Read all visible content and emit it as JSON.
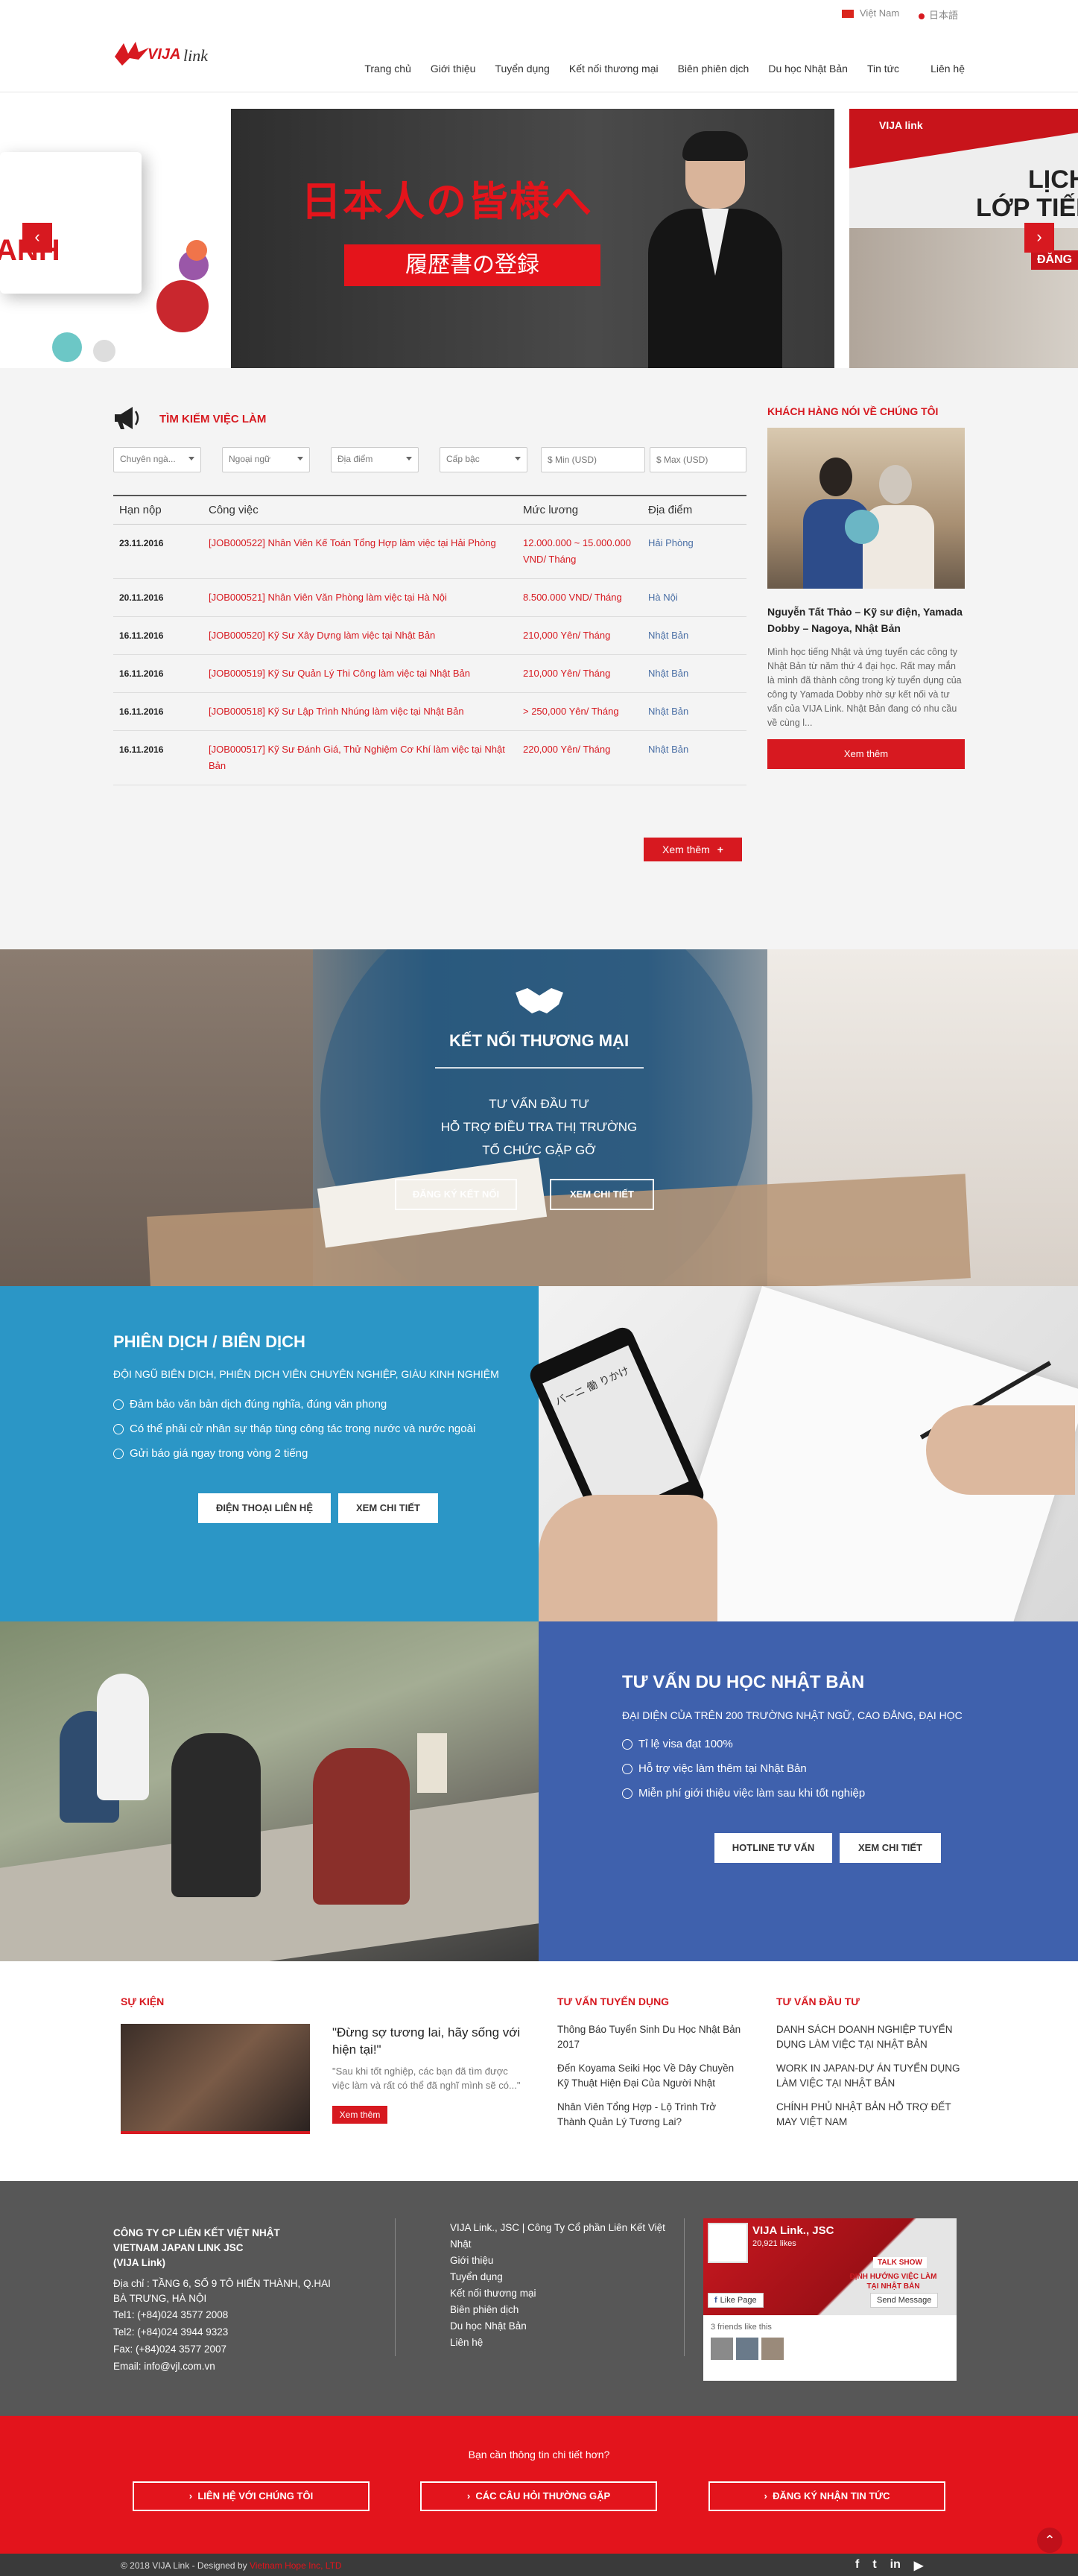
{
  "topbar": {
    "lang_vn": "Việt Nam",
    "lang_jp": "日本語"
  },
  "header": {
    "logo_text": "link",
    "logo_brand": "VIJA",
    "nav": [
      "Trang chủ",
      "Giới thiệu",
      "Tuyển dụng",
      "Kết nối thương mại",
      "Biên phiên dịch",
      "Du học Nhật Bản",
      "Tin tức",
      "Liên hệ"
    ]
  },
  "slider": {
    "left_text": "ANH",
    "main_jp_title": "日本人の皆様へ",
    "main_jp_sub": "履歴書の登録",
    "right_lines": [
      "LỊCH",
      "LỚP TIẾNG"
    ],
    "right_badge": "ĐĂNG",
    "right_brand": "VIJA link"
  },
  "jobs": {
    "title": "TÌM KIẾM VIỆC LÀM",
    "filters": [
      "Chuyên ngà...",
      "Ngoại ngữ",
      "Địa điểm",
      "Cấp bậc"
    ],
    "min_placeholder": "$ Min (USD)",
    "max_placeholder": "$ Max (USD)",
    "headers": [
      "Hạn nộp",
      "Công việc",
      "Mức lương",
      "Địa điểm"
    ],
    "rows": [
      {
        "date": "23.11.2016",
        "title": "[JOB000522] Nhân Viên Kế Toán Tổng Hợp làm việc tại Hải Phòng",
        "salary": "12.000.000 ~ 15.000.000 VND/ Tháng",
        "loc": "Hải Phòng"
      },
      {
        "date": "20.11.2016",
        "title": "[JOB000521] Nhân Viên Văn Phòng làm việc tại Hà Nội",
        "salary": "8.500.000 VND/ Tháng",
        "loc": "Hà Nội"
      },
      {
        "date": "16.11.2016",
        "title": "[JOB000520] Kỹ Sư Xây Dựng làm việc tại Nhật Bản",
        "salary": "210,000 Yên/ Tháng",
        "loc": "Nhật Bản"
      },
      {
        "date": "16.11.2016",
        "title": "[JOB000519] Kỹ Sư Quản Lý Thi Công làm việc tại Nhật Bản",
        "salary": "210,000 Yên/ Tháng",
        "loc": "Nhật Bản"
      },
      {
        "date": "16.11.2016",
        "title": "[JOB000518] Kỹ Sư Lập Trình Nhúng làm việc tại Nhật Bản",
        "salary": "> 250,000 Yên/ Tháng",
        "loc": "Nhật Bản"
      },
      {
        "date": "16.11.2016",
        "title": "[JOB000517] Kỹ Sư Đánh Giá, Thử Nghiệm Cơ Khí làm việc tại Nhật Bản",
        "salary": "220,000 Yên/ Tháng",
        "loc": "Nhật Bản"
      }
    ],
    "more": "Xem thêm"
  },
  "testimonial": {
    "title": "KHÁCH HÀNG NÓI VỀ CHÚNG TÔI",
    "name": "Nguyễn Tất Thảo – Kỹ sư điện, Yamada Dobby – Nagoya, Nhật Bản",
    "text": "Mình học tiếng Nhật và ứng tuyển các công ty Nhật Bản từ năm thứ 4 đại học. Rất may mắn là mình đã thành công trong kỳ tuyển dụng của công ty Yamada Dobby nhờ sự kết nối và tư vấn của VIJA Link. Nhật Bản đang có nhu cầu về cùng l...",
    "more": "Xem thêm"
  },
  "ketnoi": {
    "title": "KẾT NỐI THƯƠNG MẠI",
    "lines": [
      "TƯ VẤN ĐẦU TƯ",
      "HỖ TRỢ ĐIỀU TRA THỊ TRƯỜNG",
      "TỔ CHỨC GẶP GỠ"
    ],
    "btn1": "ĐĂNG KÝ KẾT NỐI",
    "btn2": "XEM CHI TIẾT"
  },
  "translation": {
    "title": "PHIÊN DỊCH / BIÊN DỊCH",
    "subtitle": "ĐỘI NGŨ BIÊN DỊCH, PHIÊN DỊCH VIÊN CHUYÊN NGHIỆP, GIÀU KINH NGHIỆM",
    "bullets": [
      "Đảm bảo văn bản dịch đúng nghĩa, đúng văn phong",
      "Có thể phải cử nhân sự tháp tùng công tác trong nước và nước ngoài",
      "Gửi báo giá ngay trong vòng 2 tiếng"
    ],
    "btn1": "ĐIỆN THOẠI LIÊN HỆ",
    "btn2": "XEM CHI TIẾT",
    "phone_text": "バーニ 働 りかけ"
  },
  "study": {
    "title": "TƯ VẤN DU HỌC NHẬT BẢN",
    "subtitle": "ĐẠI DIỆN CỦA TRÊN 200 TRƯỜNG NHẬT NGỮ, CAO ĐẲNG, ĐẠI HỌC",
    "bullets": [
      "Tỉ lệ visa đạt 100%",
      "Hỗ trợ việc làm thêm tại Nhật Bản",
      "Miễn phí giới thiệu việc làm sau khi tốt nghiệp"
    ],
    "btn1": "HOTLINE TƯ VẤN",
    "btn2": "XEM CHI TIẾT"
  },
  "news": {
    "events_title": "SỰ KIỆN",
    "event_quote": "\"Đừng sợ tương lai, hãy sống với hiện tại!\"",
    "event_text": "\"Sau khi tốt nghiệp, các bạn đã tìm được việc làm và rất có thể đã nghĩ mình sẽ có...\"",
    "event_more": "Xem thêm",
    "recruit_title": "TƯ VẤN TUYỂN DỤNG",
    "recruit_items": [
      "Thông Báo Tuyển Sinh Du Học Nhật Bản 2017",
      "Đến Koyama Seiki Học Về Dây Chuyền Kỹ Thuật Hiện Đại Của Người Nhật",
      "Nhân Viên Tổng Hợp - Lộ Trình Trở Thành Quản Lý Tương Lai?"
    ],
    "invest_title": "TƯ VẤN ĐẦU TƯ",
    "invest_items": [
      "DANH SÁCH DOANH NGHIỆP TUYỂN DỤNG LÀM VIỆC TẠI NHẬT BẢN",
      "WORK IN JAPAN-DỰ ÁN TUYỂN DỤNG LÀM VIỆC TẠI NHẬT BẢN",
      "CHÍNH PHỦ NHẬT BẢN HỖ TRỢ ĐẾT MAY VIỆT NAM"
    ]
  },
  "footer": {
    "company": [
      "CÔNG TY CP LIÊN KẾT VIỆT NHẬT",
      "VIETNAM JAPAN LINK JSC",
      "(VIJA Link)"
    ],
    "address": "Địa chỉ : TẦNG 6, SỐ 9 TÔ HIẾN THÀNH, Q.HAI BÀ TRƯNG, HÀ NỘI",
    "tel1": "Tel1: (+84)024 3577 2008",
    "tel2": "Tel2: (+84)024 3944 9323",
    "fax": "Fax: (+84)024 3577 2007",
    "email": "Email: info@vjl.com.vn",
    "links": [
      "VIJA Link., JSC | Công Ty Cổ phần Liên Kết Việt Nhật",
      "Giới thiệu",
      "Tuyển dụng",
      "Kết nối thương mại",
      "Biên phiên dịch",
      "Du học Nhật Bản",
      "Liên hệ"
    ],
    "fb_name": "VIJA Link., JSC",
    "fb_likes": "20,921 likes",
    "fb_like_btn": "Like Page",
    "fb_send_btn": "Send Message",
    "fb_friends": "3 friends like this",
    "fb_banner_1": "TALK SHOW",
    "fb_banner_2": "ĐỊNH HƯỚNG VIỆC LÀM",
    "fb_banner_3": "TẠI NHẬT BẢN"
  },
  "cta": {
    "question": "Bạn cần thông tin chi tiết hơn?",
    "btn1": "LIÊN HỆ VỚI CHÚNG TÔI",
    "btn2": "CÁC CÂU HỎI THƯỜNG GẶP",
    "btn3": "ĐĂNG KÝ NHẬN TIN TỨC"
  },
  "bottom": {
    "copyright": "© 2018 VIJA Link - Designed by",
    "designer": "Vietnam Hope Inc, LTD"
  },
  "colors": {
    "brand_red": "#d71920",
    "blue_section": "#2b96c6",
    "navy_section": "#3f61ad",
    "footer_gray": "#575757"
  }
}
